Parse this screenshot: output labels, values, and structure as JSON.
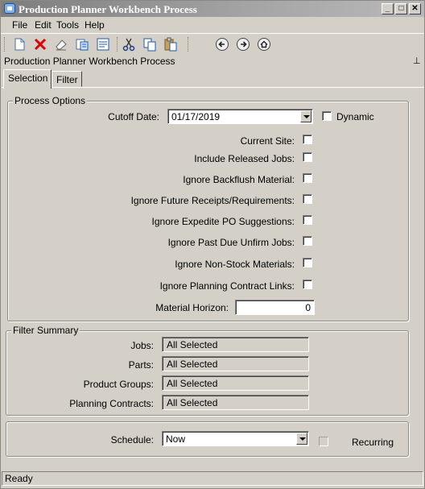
{
  "window": {
    "title": "Production Planner Workbench Process"
  },
  "menu": {
    "file": "File",
    "edit": "Edit",
    "tools": "Tools",
    "help": "Help"
  },
  "toolbar_icons": [
    "new-icon",
    "delete-icon",
    "clear-icon",
    "attach-icon",
    "print-preview-icon",
    "cut-icon",
    "copy-icon",
    "paste-icon",
    "back-icon",
    "forward-icon",
    "home-icon"
  ],
  "panel": {
    "title": "Production Planner Workbench Process"
  },
  "tabs": {
    "selection": "Selection",
    "filter": "Filter"
  },
  "process_options": {
    "legend": "Process Options",
    "cutoff_label": "Cutoff Date:",
    "cutoff_value": "01/17/2019",
    "dynamic_label": "Dynamic",
    "checkboxes": [
      {
        "label": "Current Site:",
        "checked": false
      },
      {
        "label": "Include Released Jobs:",
        "checked": false
      },
      {
        "label": "Ignore Backflush Material:",
        "checked": false
      },
      {
        "label": "Ignore Future Receipts/Requirements:",
        "checked": false
      },
      {
        "label": "Ignore Expedite PO Suggestions:",
        "checked": false
      },
      {
        "label": "Ignore Past Due Unfirm Jobs:",
        "checked": false
      },
      {
        "label": "Ignore Non-Stock Materials:",
        "checked": false
      },
      {
        "label": "Ignore Planning Contract Links:",
        "checked": false
      }
    ],
    "horizon_label": "Material Horizon:",
    "horizon_value": "0"
  },
  "filter_summary": {
    "legend": "Filter Summary",
    "rows": [
      {
        "label": "Jobs:",
        "value": "All Selected"
      },
      {
        "label": "Parts:",
        "value": "All Selected"
      },
      {
        "label": "Product Groups:",
        "value": "All Selected"
      },
      {
        "label": "Planning Contracts:",
        "value": "All Selected"
      }
    ]
  },
  "schedule": {
    "label": "Schedule:",
    "value": "Now",
    "recurring_label": "Recurring"
  },
  "status": {
    "text": "Ready"
  }
}
